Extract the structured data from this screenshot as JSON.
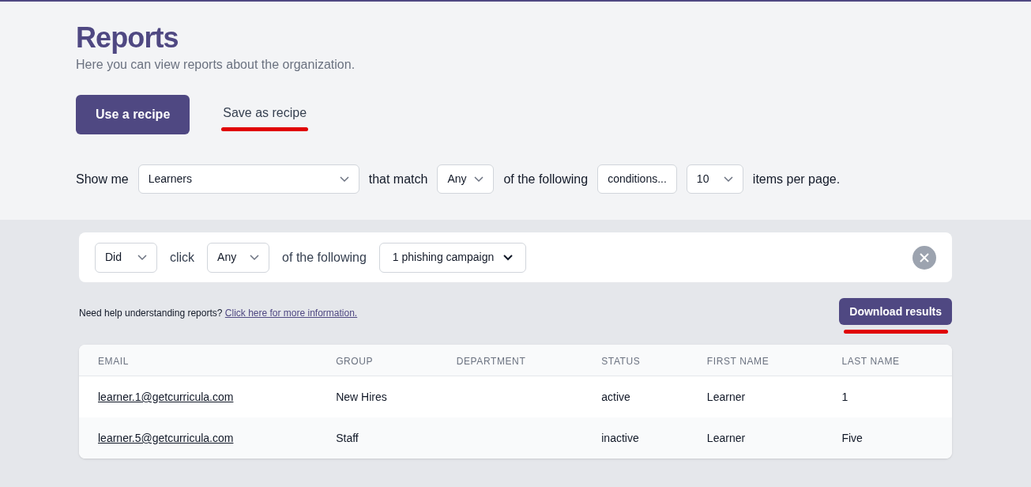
{
  "header": {
    "title": "Reports",
    "subtitle": "Here you can view reports about the organization."
  },
  "actions": [
    {
      "kind": "primary",
      "label": "Use a recipe",
      "annotated": false
    },
    {
      "kind": "link",
      "label": "Save as recipe",
      "annotated": true
    }
  ],
  "query": [
    {
      "kind": "text",
      "label": "Show me"
    },
    {
      "kind": "wide_select",
      "value": "Learners"
    },
    {
      "kind": "text",
      "label": "that match"
    },
    {
      "kind": "select",
      "value": "Any"
    },
    {
      "kind": "text",
      "label": "of the following"
    },
    {
      "kind": "button",
      "value": "conditions..."
    },
    {
      "kind": "select",
      "value": "10"
    },
    {
      "kind": "text",
      "label": "items per page."
    }
  ],
  "condition": [
    {
      "kind": "select",
      "value": "Did"
    },
    {
      "kind": "text",
      "label": "click"
    },
    {
      "kind": "select",
      "value": "Any"
    },
    {
      "kind": "text",
      "label": "of the following"
    },
    {
      "kind": "dropdown",
      "value": "1 phishing campaign"
    }
  ],
  "help": {
    "text": "Need help understanding reports?",
    "link": "Click here for more information."
  },
  "download": {
    "label": "Download results",
    "annotated": true
  },
  "table": {
    "columns": [
      "EMAIL",
      "GROUP",
      "DEPARTMENT",
      "STATUS",
      "FIRST NAME",
      "LAST NAME"
    ],
    "rows": [
      [
        "learner.1@getcurricula.com",
        "New Hires",
        "",
        "active",
        "Learner",
        "1"
      ],
      [
        "learner.5@getcurricula.com",
        "Staff",
        "",
        "inactive",
        "Learner",
        "Five"
      ]
    ]
  }
}
